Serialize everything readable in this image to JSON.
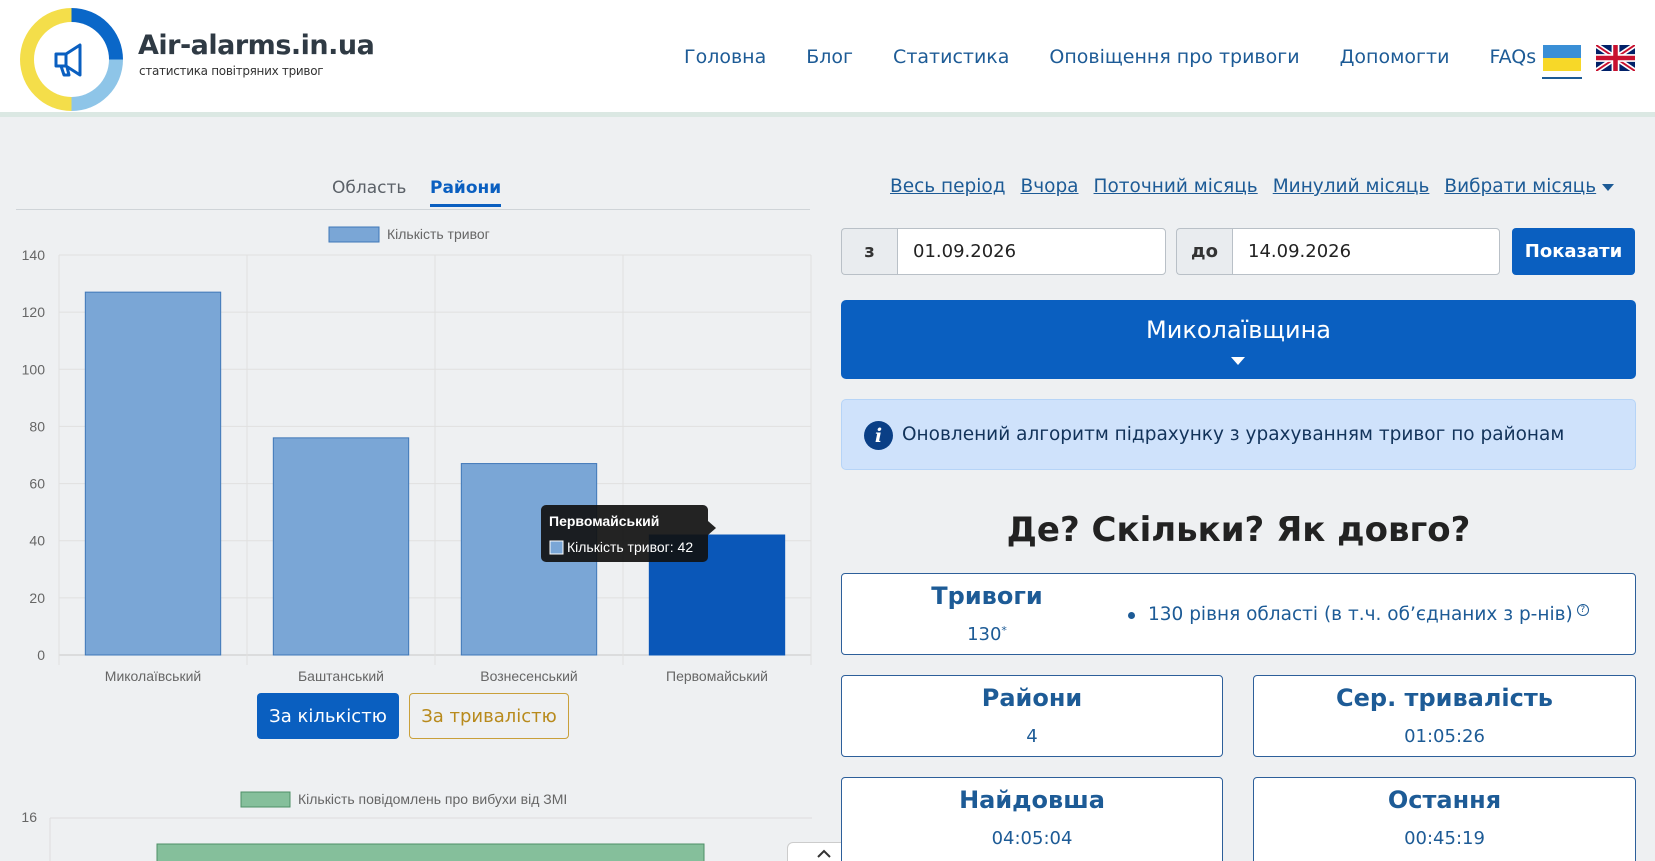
{
  "header": {
    "brand_name": "Air-alarms.in.ua",
    "brand_sub": "статистика повітряних тривог",
    "nav": [
      "Головна",
      "Блог",
      "Статистика",
      "Оповіщення про тривоги",
      "Допомогти",
      "FAQs"
    ]
  },
  "tabs": {
    "oblast": "Область",
    "raions": "Райони"
  },
  "chart_data": [
    {
      "type": "bar",
      "legend": [
        "Кількість тривог"
      ],
      "categories": [
        "Миколаївський",
        "Баштанський",
        "Вознесенський",
        "Первомайський"
      ],
      "series": [
        {
          "name": "Кількість тривог",
          "values": [
            127,
            76,
            67,
            42
          ]
        }
      ],
      "ylim": [
        0,
        140
      ],
      "yticks": [
        0,
        20,
        40,
        60,
        80,
        100,
        120,
        140
      ],
      "highlighted_index": 3,
      "tooltip": {
        "title": "Первомайський",
        "label": "Кількість тривог: 42"
      },
      "colors": {
        "bar": "#7aa6d6",
        "bar_border": "#3f77b8",
        "highlight": "#0a57b8"
      },
      "grid": true
    },
    {
      "type": "bar",
      "legend": [
        "Кількість повідомлень про вибухи від ЗМІ"
      ],
      "yticks": [
        16
      ],
      "colors": {
        "bar": "#85bf9b",
        "bar_border": "#4d8f67"
      }
    }
  ],
  "chart_buttons": {
    "by_count": "За кількістю",
    "by_duration": "За тривалістю"
  },
  "period_links": [
    "Весь період",
    "Вчора",
    "Поточний місяць",
    "Минулий місяць",
    "Вибрати місяць"
  ],
  "date_range": {
    "from_prefix": "з",
    "from_value": "01.09.2026",
    "to_prefix": "до",
    "to_value": "14.09.2026",
    "show_button": "Показати"
  },
  "region": {
    "name": "Миколаївщина"
  },
  "info": {
    "icon": "i",
    "text": "Оновлений алгоритм підрахунку з урахуванням тривог по районам"
  },
  "section_title": "Де? Скільки? Як довго?",
  "stats": {
    "alarms": {
      "title": "Тривоги",
      "value": "130",
      "mark": "*",
      "bullet": "130 рівня області (в т.ч. об’єднаних з р-нів)",
      "help": "?"
    },
    "raions": {
      "title": "Райони",
      "value": "4"
    },
    "avg_duration": {
      "title": "Сер. тривалість",
      "value": "01:05:26"
    },
    "longest": {
      "title": "Найдовша",
      "value": "04:05:04"
    },
    "last": {
      "title": "Остання",
      "value": "00:45:19"
    }
  }
}
